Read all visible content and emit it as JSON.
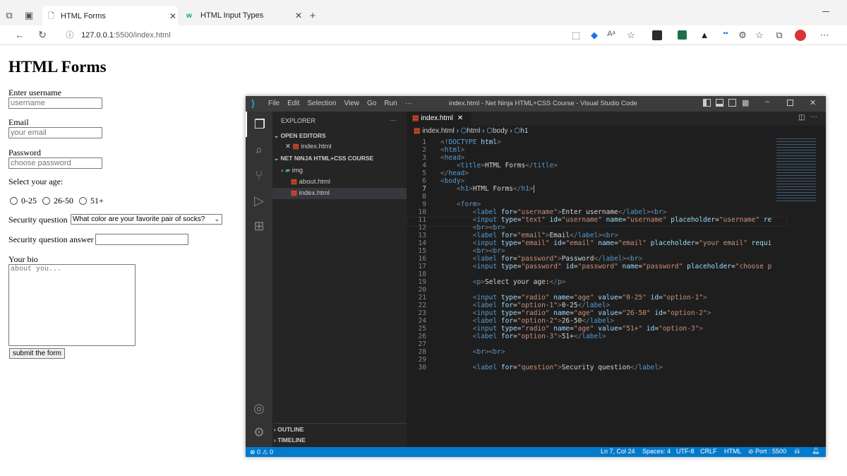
{
  "browser": {
    "tabs": [
      {
        "title": "HTML Forms",
        "active": true
      },
      {
        "title": "HTML Input Types",
        "active": false
      }
    ],
    "url_host": "127.0.0.1",
    "url_path": ":5500/index.html",
    "zoom_label": "Aᵃ"
  },
  "page": {
    "heading": "HTML Forms",
    "username_label": "Enter username",
    "username_placeholder": "username",
    "email_label": "Email",
    "email_placeholder": "your email",
    "password_label": "Password",
    "password_placeholder": "choose password",
    "age_label": "Select your age:",
    "age_options": [
      "0-25",
      "26-50",
      "51+"
    ],
    "question_label": "Security question",
    "question_selected": "What color are your favorite pair of socks?",
    "answer_label": "Security question answer",
    "bio_label": "Your bio",
    "bio_placeholder": "about you...",
    "submit_label": "submit the form"
  },
  "vscode": {
    "menu": [
      "File",
      "Edit",
      "Selection",
      "View",
      "Go",
      "Run",
      "···"
    ],
    "title": "index.html - Net Ninja HTML+CSS Course - Visual Studio Code",
    "explorer_title": "EXPLORER",
    "open_editors_title": "OPEN EDITORS",
    "open_editor_file": "index.html",
    "project_title": "NET NINJA HTML+CSS COURSE",
    "tree": [
      "img",
      "about.html",
      "index.html"
    ],
    "outline_title": "OUTLINE",
    "timeline_title": "TIMELINE",
    "tab_label": "index.html",
    "breadcrumb": [
      "index.html",
      "html",
      "body",
      "h1"
    ],
    "line_numbers": [
      "1",
      "2",
      "3",
      "4",
      "5",
      "6",
      "7",
      "8",
      "9",
      "10",
      "11",
      "12",
      "13",
      "14",
      "15",
      "16",
      "17",
      "18",
      "19",
      "20",
      "21",
      "22",
      "23",
      "24",
      "25",
      "26",
      "27",
      "28",
      "29",
      "30"
    ],
    "status": {
      "problems": "⊗ 0 ⚠ 0",
      "position": "Ln 7, Col 24",
      "spaces": "Spaces: 4",
      "encoding": "UTF-8",
      "eol": "CRLF",
      "language": "HTML",
      "port": "⊘ Port : 5500"
    }
  },
  "colors": {
    "accent": "#007acc",
    "html_icon": "#e44d26",
    "tag": "#569cd6",
    "attr": "#9cdcfe",
    "string": "#ce9178"
  }
}
